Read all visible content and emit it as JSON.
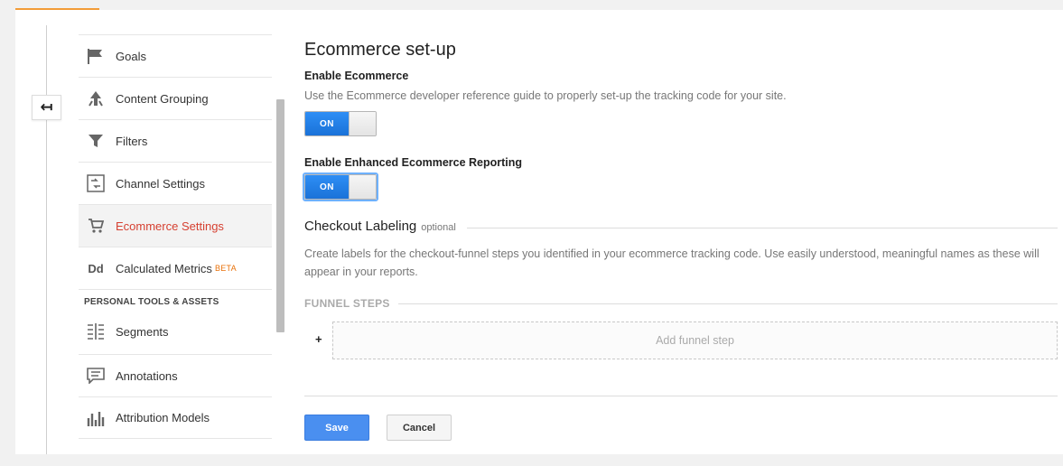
{
  "nav": {
    "items": [
      {
        "label": "Goals",
        "icon": "flag-icon"
      },
      {
        "label": "Content Grouping",
        "icon": "content-grouping-icon"
      },
      {
        "label": "Filters",
        "icon": "filter-icon"
      },
      {
        "label": "Channel Settings",
        "icon": "channel-settings-icon"
      },
      {
        "label": "Ecommerce Settings",
        "icon": "cart-icon",
        "active": true
      },
      {
        "label": "Calculated Metrics",
        "icon": "calculated-metrics-icon",
        "badge": "BETA"
      }
    ],
    "section_title": "PERSONAL TOOLS & ASSETS",
    "tools": [
      {
        "label": "Segments",
        "icon": "segments-icon"
      },
      {
        "label": "Annotations",
        "icon": "annotations-icon"
      },
      {
        "label": "Attribution Models",
        "icon": "attribution-models-icon"
      }
    ],
    "dd_glyph": "Dd",
    "collapse_glyph": "↤"
  },
  "main": {
    "title": "Ecommerce set-up",
    "enable_ecommerce": {
      "label": "Enable Ecommerce",
      "description": "Use the Ecommerce developer reference guide to properly set-up the tracking code for your site.",
      "toggle": "ON"
    },
    "enhanced": {
      "label": "Enable Enhanced Ecommerce Reporting",
      "toggle": "ON"
    },
    "checkout": {
      "title": "Checkout Labeling",
      "optional": "optional",
      "description": "Create labels for the checkout-funnel steps you identified in your ecommerce tracking code. Use easily understood, meaningful names as these will appear in your reports."
    },
    "funnel": {
      "header": "FUNNEL STEPS",
      "plus": "+",
      "add_step": "Add funnel step"
    },
    "buttons": {
      "save": "Save",
      "cancel": "Cancel"
    }
  },
  "colors": {
    "accent_orange": "#f29c38",
    "active_red": "#d64031",
    "toggle_blue": "#1a72d8",
    "save_blue": "#4a8ff0",
    "beta_orange": "#e8710a"
  }
}
